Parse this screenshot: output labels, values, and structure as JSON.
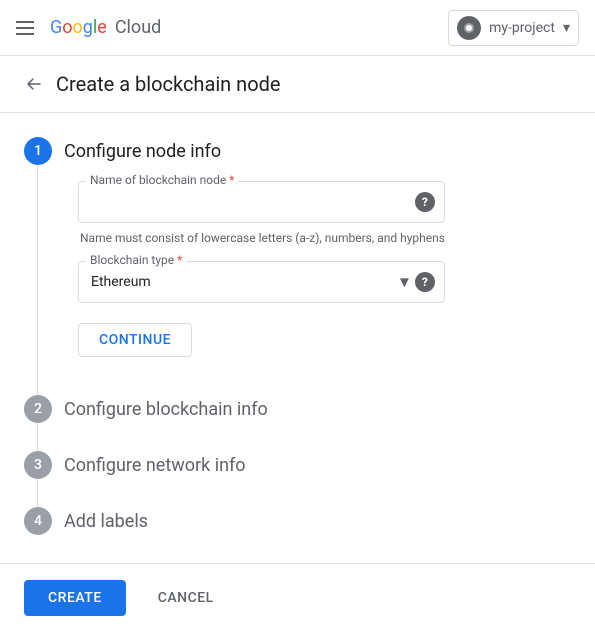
{
  "navbar": {
    "menu_icon": "hamburger",
    "logo_text": "Google Cloud",
    "project_name": "my-project",
    "chevron_icon": "chevron-down"
  },
  "page": {
    "back_icon": "arrow-back",
    "title": "Create a blockchain node"
  },
  "steps": [
    {
      "number": "1",
      "label": "Configure node info",
      "active": true
    },
    {
      "number": "2",
      "label": "Configure blockchain info",
      "active": false
    },
    {
      "number": "3",
      "label": "Configure network info",
      "active": false
    },
    {
      "number": "4",
      "label": "Add labels",
      "active": false
    }
  ],
  "step1": {
    "node_name_label": "Name of blockchain node",
    "node_name_placeholder": "",
    "node_name_hint": "Name must consist of lowercase letters (a-z), numbers, and hyphens",
    "blockchain_type_label": "Blockchain type",
    "blockchain_type_value": "Ethereum",
    "blockchain_type_options": [
      "Ethereum"
    ],
    "continue_label": "CONTINUE"
  },
  "actions": {
    "create_label": "CREATE",
    "cancel_label": "CANCEL"
  }
}
